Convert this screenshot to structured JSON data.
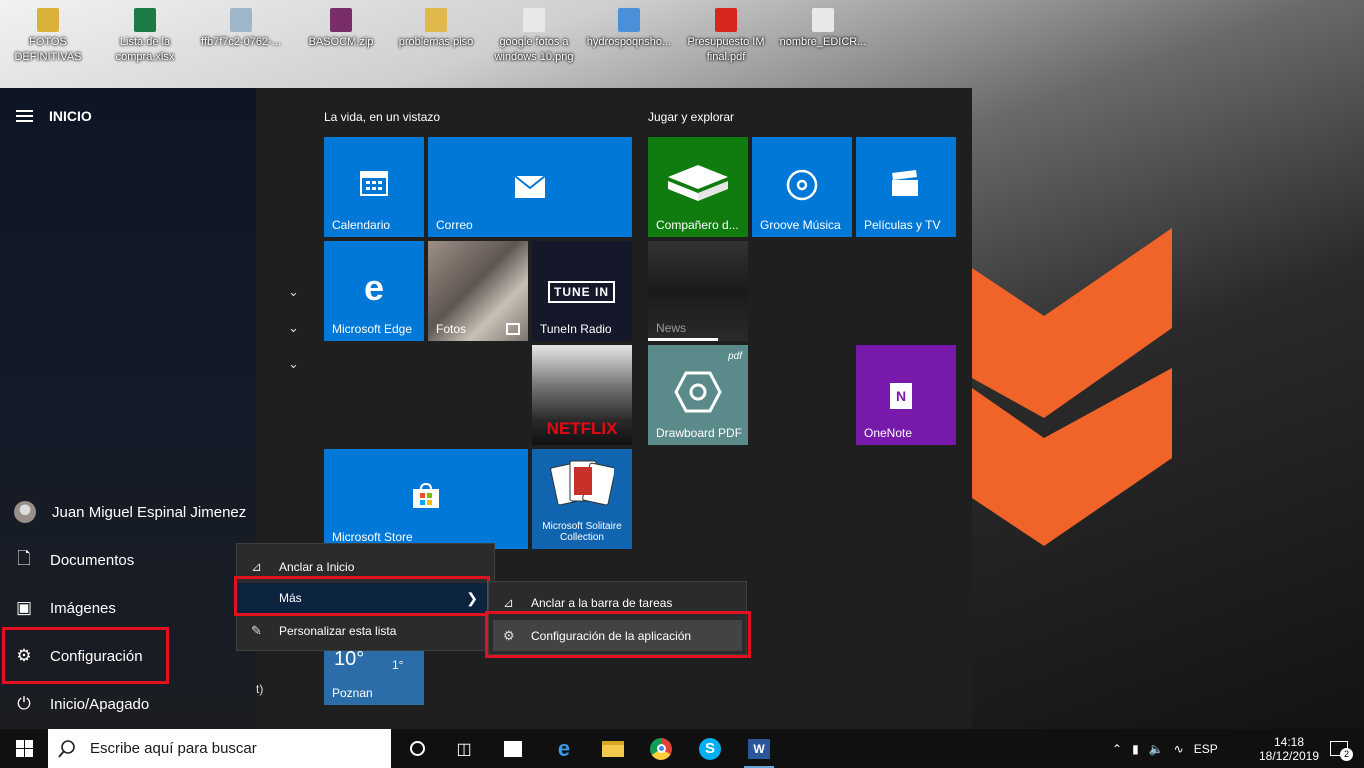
{
  "desktop": {
    "icons": [
      {
        "label": "FOTOS DEFINITIVAS",
        "icon": "folder-zip-icon",
        "color": "#d9b13b"
      },
      {
        "label": "Lista de la compra.xlsx",
        "icon": "excel-file-icon",
        "color": "#1e7a45"
      },
      {
        "label": "ffb7f7c2-0762-...",
        "icon": "phone-image-icon",
        "color": "#9fb6c9"
      },
      {
        "label": "BASOCM.zip",
        "icon": "winrar-archive-icon",
        "color": "#7a2d6b"
      },
      {
        "label": "problemas piso",
        "icon": "folder-icon",
        "color": "#e0b84c"
      },
      {
        "label": "google fotos a windows 10.png",
        "icon": "png-file-icon",
        "color": "#e8e8e8"
      },
      {
        "label": "hydrospoqnsho...",
        "icon": "app-shortcut-icon",
        "color": "#4a90d9"
      },
      {
        "label": "Presupuesto IM final.pdf",
        "icon": "pdf-file-icon",
        "color": "#d9261c"
      },
      {
        "label": "nombre_EDICR...",
        "icon": "image-file-icon",
        "color": "#e8e8e8"
      }
    ]
  },
  "start": {
    "header": "INICIO",
    "user": "Juan Miguel Espinal Jimenez",
    "rail_items": [
      {
        "label": "Documentos",
        "icon": "document-icon"
      },
      {
        "label": "Imágenes",
        "icon": "pictures-icon"
      },
      {
        "label": "Configuración",
        "icon": "gear-icon"
      },
      {
        "label": "Inicio/Apagado",
        "icon": "power-icon"
      }
    ],
    "list_fragment": "t)"
  },
  "groups": {
    "life": "La vida, en un vistazo",
    "play": "Jugar y explorar"
  },
  "tiles": {
    "calendario": "Calendario",
    "correo": "Correo",
    "edge": "Microsoft Edge",
    "fotos": "Fotos",
    "tunein": "TuneIn Radio",
    "tunein_logo": "TUNE IN",
    "netflix": "NETFLIX",
    "store": "Microsoft Store",
    "solitaire": "Microsoft Solitaire Collection",
    "companion": "Compañero d...",
    "groove": "Groove Música",
    "peliculas": "Películas y TV",
    "news": "News",
    "drawboard": "Drawboard PDF",
    "drawboard_mark": "pdf",
    "onenote": "OneNote",
    "weather_temp": "10°",
    "weather_low": "1°",
    "weather_city": "Poznan"
  },
  "context_menu": {
    "pin": "Anclar a Inicio",
    "more": "Más",
    "customize": "Personalizar esta lista"
  },
  "submenu": {
    "pin_taskbar": "Anclar a la barra de tareas",
    "app_settings": "Configuración de la aplicación"
  },
  "taskbar": {
    "search_placeholder": "Escribe aquí para buscar",
    "lang": "ESP",
    "time": "14:18",
    "date": "18/12/2019",
    "notifications": "2"
  },
  "colors": {
    "accent": "#0078d7",
    "highlight": "#e3101f",
    "wallpaper_logo": "#f0642a"
  }
}
